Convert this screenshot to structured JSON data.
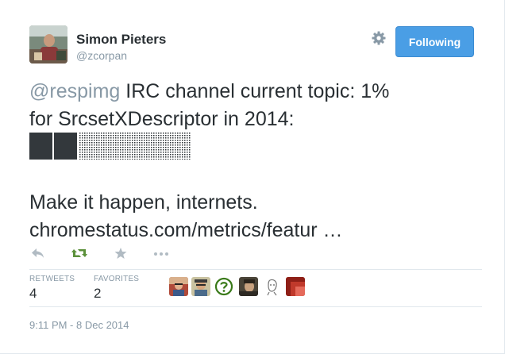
{
  "author": {
    "name": "Simon Pieters",
    "handle": "@zcorpan",
    "avatar_icon": "profile-photo"
  },
  "header": {
    "follow_label": "Following",
    "settings_icon": "gear-icon"
  },
  "tweet": {
    "mention": "@respimg",
    "line1_rest": " IRC channel current topic: 1%",
    "line2": "for SrcsetXDescriptor in 2014:",
    "progress_fraction": 0.01,
    "line4": "Make it happen, internets.",
    "link_text": "chromestatus.com/metrics/featur …"
  },
  "actions": {
    "reply_icon": "reply-icon",
    "retweet_icon": "retweet-icon",
    "favorite_icon": "star-icon",
    "more_icon": "more-icon"
  },
  "stats": {
    "retweets_label": "RETWEETS",
    "retweets_count": "4",
    "favorites_label": "FAVORITES",
    "favorites_count": "2"
  },
  "timestamp": "9:11 PM - 8 Dec 2014",
  "colors": {
    "accent": "#4a9ee5",
    "retweeted": "#5c913b",
    "muted": "#8899a6"
  }
}
